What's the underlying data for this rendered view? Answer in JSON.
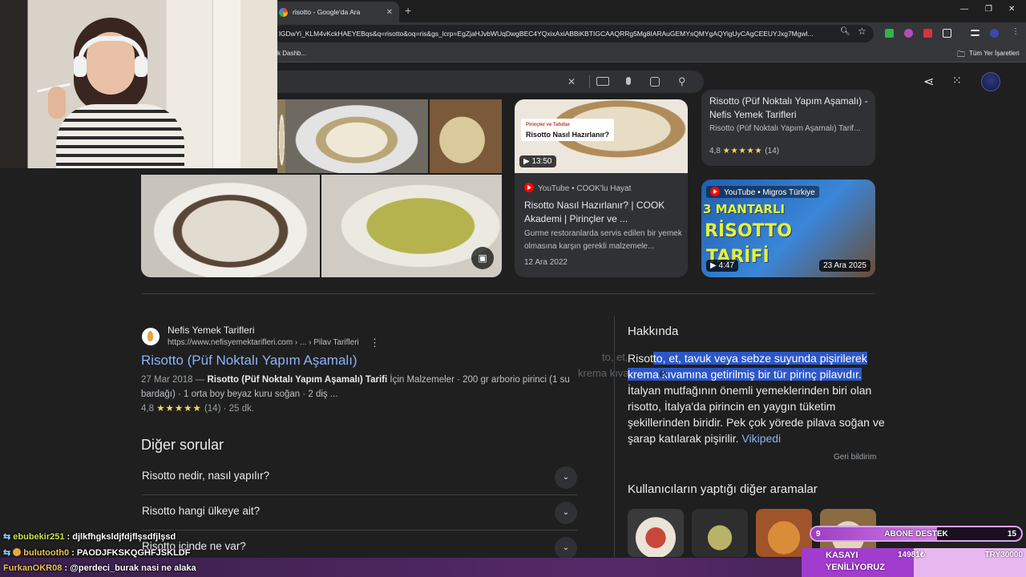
{
  "browser": {
    "tab_title": "risotto - Google'da Ara",
    "url": "lGDwYi_KLM4vKckHAEYEBqs&q=risotto&oq=ris&gs_lcrp=EgZjaHJvbWUqDwgBEC4YQxixAxiABBiKBTIGCAAQRRg5Mg8IARAuGEMYsQMYgAQYigUyCAgCEEUYJxg7Mgwl...",
    "bookmark_left": "k Dashb...",
    "bookmark_right": "Tüm Yer İşaretleri",
    "icons": [
      "close-icon",
      "plus-icon",
      "minimize-icon",
      "restore-icon",
      "zoom-icon",
      "star-icon",
      "bookmark-folder-icon"
    ]
  },
  "google": {
    "search_icons": [
      "clear-icon",
      "keyboard-icon",
      "mic-icon",
      "lens-icon",
      "search-icon"
    ],
    "header_icons": [
      "share-icon",
      "apps-icon"
    ]
  },
  "top_cards": {
    "recipe_card": {
      "title": "Risotto (Püf Noktalı Yapım Aşamalı) - Nefis Yemek Tarifleri",
      "snippet": "Risotto (Püf Noktalı Yapım Aşamalı) Tarif...",
      "rating": "4,8",
      "stars": "★★★★★",
      "count": "(14)"
    },
    "video1": {
      "thumb_overlay_top": "Pirinçler ve Tahıllar",
      "thumb_overlay": "Risotto Nasıl Hazırlanır?",
      "duration": "13:50",
      "source": "YouTube • COOK'lu Hayat",
      "title": "Risotto Nasıl Hazırlanır? | COOK Akademi | Pirinçler ve ...",
      "desc": "Gurme restoranlarda servis edilen bir yemek olmasına karşın gerekli malzemele...",
      "date": "12 Ara 2022"
    },
    "video2": {
      "source": "YouTube • Migros Türkiye",
      "thumb_line1": "3 MANTARLI",
      "thumb_line2": "RİSOTTO",
      "thumb_line3": "TARİFİ",
      "duration": "4:47",
      "date": "23 Ara 2025"
    }
  },
  "result": {
    "site_name": "Nefis Yemek Tarifleri",
    "url": "https://www.nefisyemektarifleri.com › ... › Pilav Tarifleri",
    "more_icon": "more-vert-icon",
    "title": "Risotto (Püf Noktalı Yapım Aşamalı)",
    "date": "27 Mar 2018 — ",
    "snippet_bold": "Risotto (Püf Noktalı Yapım Aşamalı) Tarifi",
    "snippet_rest": " İçin Malzemeler · 200 gr arborio pirinci (1 su",
    "snippet_line2": "bardağı) · 1 orta boy beyaz kuru soğan · 2 diş ...",
    "rating": "4,8",
    "stars": "★★★★★",
    "rating_rest": " (14) · 25 dk."
  },
  "questions": {
    "heading": "Diğer sorular",
    "items": [
      "Risotto nedir, nasıl yapılır?",
      "Risotto hangi ülkeye ait?",
      "Risotto içinde ne var?"
    ]
  },
  "about": {
    "heading": "Hakkında",
    "line1_a": "Risot",
    "line1_b": "to, et, tavuk veya sebze suyunda pişirilerek",
    "line2": "krema kıvamına getirilmiş bir tür pirinç pilavıdır.",
    "line3": "İtalyan mutfağının önemli yemeklerinden biri olan",
    "line4": "risotto, İtalya'da pirincin en yaygın tüketim",
    "line5": "şekillerinden biridir. Pek çok yörede pilava soğan ve",
    "line6": "şarap katılarak pişirilir. ",
    "source_link": "Vikipedi",
    "ghost_text": "to, et,",
    "ghost_text2": "krema kıvam",
    "feedback": "Geri bildirim",
    "others_heading": "Kullanıcıların yaptığı diğer aramalar"
  },
  "chat": [
    {
      "user": "ebubekir251",
      "msg": " : djlkfhgksldjfdjflşsdfjlşsd"
    },
    {
      "user": "bulutooth0",
      "msg": " : PAODJFKSKQGHFJSKLDF"
    },
    {
      "user": "FurkanOKR08",
      "msg": " : @perdeci_burak nasi ne alaka"
    }
  ],
  "goals": {
    "goal1_left": "9",
    "goal1_label": "ABONE DESTEK",
    "goal1_right": "15",
    "goal1_progress": 0.6,
    "goal2_label_1": "KASAYI",
    "goal2_label_2": "YENİLİYORUZ",
    "goal2_mid": "14981₺",
    "goal2_right": "TRY30000",
    "goal2_progress": 0.5
  }
}
